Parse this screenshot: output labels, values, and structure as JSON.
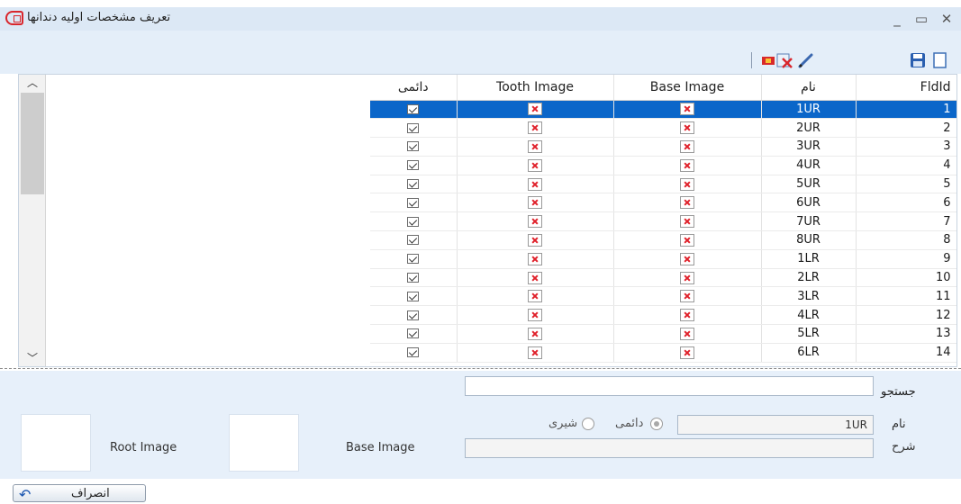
{
  "window": {
    "title": "تعریف مشخصات اولیه دندانها",
    "minimize": "_",
    "maximize": "▭",
    "close": "✕"
  },
  "toolbar": {
    "items": [
      "new-icon",
      "save-icon",
      "edit-icon",
      "delete-icon",
      "flag-icon"
    ]
  },
  "grid": {
    "columns": {
      "permanent": "دائمی",
      "tooth_image": "Tooth Image",
      "base_image": "Base Image",
      "name": "نام",
      "fldid": "FldId"
    },
    "selected_index": 0,
    "rows": [
      {
        "name": "1UR",
        "id": "1"
      },
      {
        "name": "2UR",
        "id": "2"
      },
      {
        "name": "3UR",
        "id": "3"
      },
      {
        "name": "4UR",
        "id": "4"
      },
      {
        "name": "5UR",
        "id": "5"
      },
      {
        "name": "6UR",
        "id": "6"
      },
      {
        "name": "7UR",
        "id": "7"
      },
      {
        "name": "8UR",
        "id": "8"
      },
      {
        "name": "1LR",
        "id": "9"
      },
      {
        "name": "2LR",
        "id": "10"
      },
      {
        "name": "3LR",
        "id": "11"
      },
      {
        "name": "4LR",
        "id": "12"
      },
      {
        "name": "5LR",
        "id": "13"
      },
      {
        "name": "6LR",
        "id": "14"
      }
    ]
  },
  "search": {
    "label": "جستجو",
    "value": ""
  },
  "detail": {
    "name_label": "نام",
    "name_value": "1UR",
    "desc_label": "شرح",
    "desc_value": "",
    "radio_permanent": "دائمی",
    "radio_milk": "شیری",
    "radio_selected": "permanent",
    "base_image_label": "Base Image",
    "root_image_label": "Root Image"
  },
  "footer": {
    "close_label": "انصراف"
  },
  "colors": {
    "selection": "#0b66c9",
    "panel": "#e7f0fa",
    "titlebar": "#dce8f5"
  }
}
